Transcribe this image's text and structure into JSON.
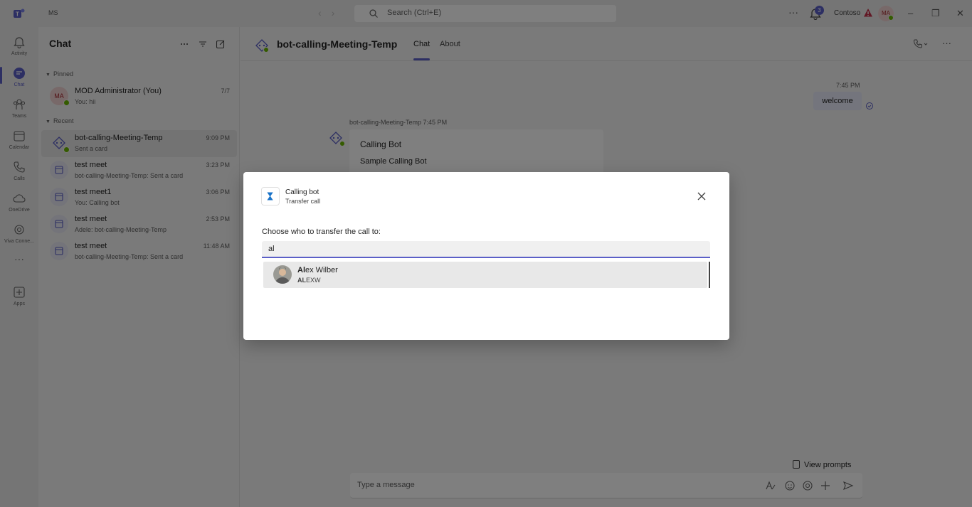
{
  "titlebar": {
    "tenant": "MS",
    "search_placeholder": "Search (Ctrl+E)",
    "more": "···",
    "notification_count": "3",
    "org": "Contoso",
    "user_initials": "MA",
    "minimize": "–",
    "restore": "❐",
    "close": "✕"
  },
  "rail": {
    "items": [
      {
        "label": "Activity",
        "icon": "bell-icon"
      },
      {
        "label": "Chat",
        "icon": "chat-icon"
      },
      {
        "label": "Teams",
        "icon": "teams-icon"
      },
      {
        "label": "Calendar",
        "icon": "calendar-icon"
      },
      {
        "label": "Calls",
        "icon": "phone-icon"
      },
      {
        "label": "OneDrive",
        "icon": "cloud-icon"
      },
      {
        "label": "Viva Conne...",
        "icon": "viva-icon"
      },
      {
        "label": "Apps",
        "icon": "plus-square-icon"
      }
    ],
    "more": "···"
  },
  "chatlist": {
    "title": "Chat",
    "pinned_label": "Pinned",
    "recent_label": "Recent",
    "pinned": [
      {
        "initials": "MA",
        "name": "MOD Administrator (You)",
        "preview": "You: hii",
        "time": "7/7"
      }
    ],
    "recent": [
      {
        "name": "bot-calling-Meeting-Temp",
        "preview": "Sent a card",
        "time": "9:09 PM"
      },
      {
        "name": "test meet",
        "preview": "bot-calling-Meeting-Temp: Sent a card",
        "time": "3:23 PM"
      },
      {
        "name": "test meet1",
        "preview": "You: Calling bot",
        "time": "3:06 PM"
      },
      {
        "name": "test meet",
        "preview": "Adele: bot-calling-Meeting-Temp",
        "time": "2:53 PM"
      },
      {
        "name": "test meet",
        "preview": "bot-calling-Meeting-Temp: Sent a card",
        "time": "11:48 AM"
      }
    ]
  },
  "main": {
    "title": "bot-calling-Meeting-Temp",
    "tabs": [
      {
        "label": "Chat"
      },
      {
        "label": "About"
      }
    ],
    "more": "···",
    "messages": {
      "right_time": "7:45 PM",
      "right_text": "welcome",
      "bot_meta": "bot-calling-Meeting-Temp  7:45 PM",
      "card_title": "Calling Bot",
      "card_sub": "Sample Calling Bot"
    },
    "view_prompts": "View prompts",
    "composer_placeholder": "Type a message"
  },
  "dialog": {
    "app_name": "Calling bot",
    "app_sub": "Transfer call",
    "label": "Choose who to transfer the call to:",
    "input_value": "al",
    "suggestion": {
      "name_match": "Al",
      "name_rest": "ex Wilber",
      "alias_match": "AL",
      "alias_rest": "EXW"
    }
  }
}
